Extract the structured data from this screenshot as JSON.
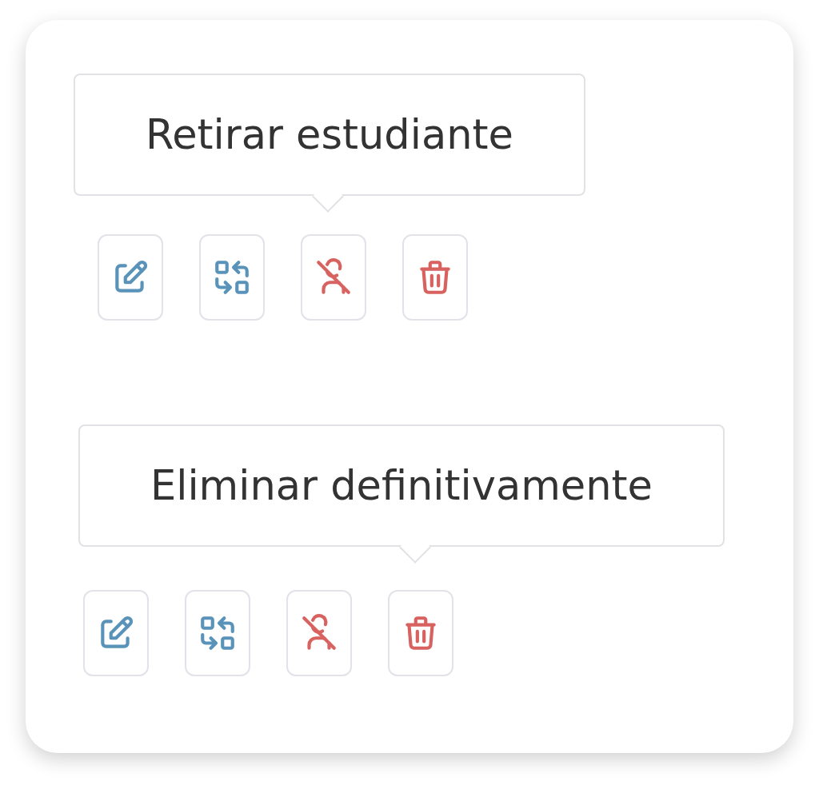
{
  "groups": [
    {
      "tooltip": "Retirar estudiante",
      "buttons": [
        {
          "kind": "edit",
          "hovered": false
        },
        {
          "kind": "swap",
          "hovered": false
        },
        {
          "kind": "withdraw",
          "hovered": true
        },
        {
          "kind": "delete",
          "hovered": false
        }
      ]
    },
    {
      "tooltip": "Eliminar definitivamente",
      "buttons": [
        {
          "kind": "edit",
          "hovered": false
        },
        {
          "kind": "swap",
          "hovered": false
        },
        {
          "kind": "withdraw",
          "hovered": false
        },
        {
          "kind": "delete",
          "hovered": true
        }
      ]
    }
  ]
}
